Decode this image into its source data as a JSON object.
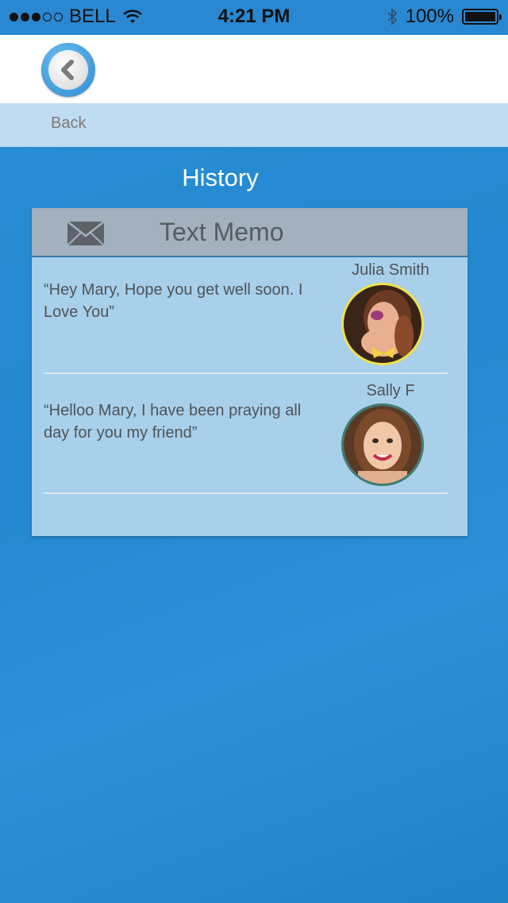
{
  "status_bar": {
    "carrier": "BELL",
    "time": "4:21 PM",
    "battery": "100%",
    "signal_bars": 3,
    "signal_total": 5
  },
  "nav": {
    "back_label": "Back"
  },
  "page": {
    "title": "History"
  },
  "card": {
    "title": "Text Memo",
    "icon": "mail-icon",
    "memos": [
      {
        "text": "“Hey Mary, Hope you get well soon. I Love You”",
        "sender": "Julia Smith"
      },
      {
        "text": "“Helloo Mary, I have been praying all day for you my friend”",
        "sender": "Sally F"
      }
    ]
  },
  "colors": {
    "background": "#2388cf",
    "card": "#a8d0ea",
    "card_header": "#a2b1bd",
    "back_strip": "#c0dcf0"
  }
}
